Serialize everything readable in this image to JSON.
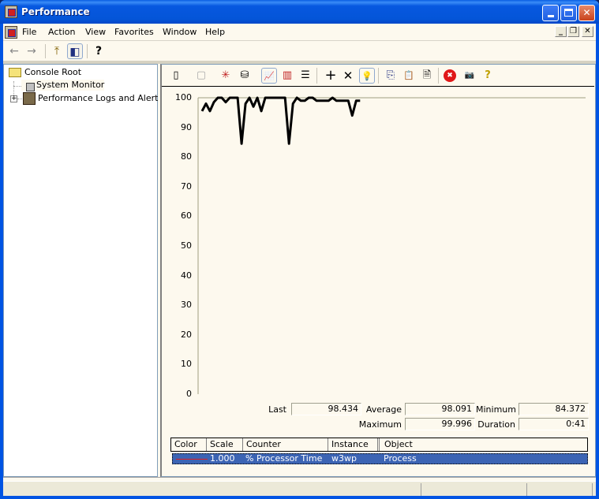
{
  "window": {
    "title": "Performance",
    "controls": {
      "minimize": "minimize",
      "maximize": "maximize",
      "close": "✕"
    }
  },
  "menubar": {
    "items": [
      "File",
      "Action",
      "View",
      "Favorites",
      "Window",
      "Help"
    ],
    "mdi_controls": {
      "minimize": "_",
      "restore": "❐",
      "close": "✕"
    }
  },
  "toolbar": {
    "buttons": [
      {
        "name": "back",
        "glyph": "←"
      },
      {
        "name": "forward",
        "glyph": "→"
      },
      {
        "name": "up-one-level",
        "glyph": "⤒"
      },
      {
        "name": "show-hide-console-tree",
        "glyph": "◧"
      },
      {
        "name": "help",
        "glyph": "?"
      }
    ]
  },
  "tree": {
    "root": "Console Root",
    "items": [
      {
        "label": "System Monitor",
        "selected": true
      },
      {
        "label": "Performance Logs and Alerts",
        "expander": "+"
      }
    ]
  },
  "system_monitor_toolbar": {
    "buttons": [
      {
        "name": "new-counter-set",
        "glyph": "▯"
      },
      {
        "name": "clear-display",
        "glyph": "▢"
      },
      {
        "name": "view-current-activity",
        "glyph": "✳"
      },
      {
        "name": "view-log-data",
        "glyph": "⛁"
      },
      {
        "name": "view-graph",
        "glyph": "📈",
        "pressed": true
      },
      {
        "name": "view-histogram",
        "glyph": "▥"
      },
      {
        "name": "view-report",
        "glyph": "☰"
      },
      {
        "name": "add",
        "glyph": "+"
      },
      {
        "name": "delete",
        "glyph": "✕"
      },
      {
        "name": "highlight",
        "glyph": "💡",
        "pressed": true
      },
      {
        "name": "copy-properties",
        "glyph": "⎘"
      },
      {
        "name": "paste-counter-list",
        "glyph": "📋"
      },
      {
        "name": "properties",
        "glyph": "🗎"
      },
      {
        "name": "freeze-display",
        "glyph": "✖"
      },
      {
        "name": "update-data",
        "glyph": "📷"
      },
      {
        "name": "help",
        "glyph": "?"
      }
    ]
  },
  "chart_data": {
    "type": "line",
    "title": "",
    "xlabel": "",
    "ylabel": "",
    "ylim": [
      0,
      100
    ],
    "yticks": [
      "100",
      "90",
      "80",
      "70",
      "60",
      "50",
      "40",
      "30",
      "20",
      "10",
      "0"
    ],
    "grid": false,
    "series": [
      {
        "name": "% Processor Time (w3wp)",
        "color": "#000000",
        "values": [
          95.5,
          98,
          95.5,
          98.5,
          100,
          100,
          98.5,
          100,
          100,
          100,
          84.5,
          98,
          100,
          97,
          100,
          95.5,
          100,
          100,
          100,
          100,
          100,
          100,
          84.5,
          98,
          100,
          99,
          99,
          100,
          100,
          99,
          99,
          99,
          99,
          100,
          99,
          99,
          99,
          99,
          94,
          99,
          99
        ]
      }
    ],
    "x_points_visible": 41,
    "x_points_capacity": 100
  },
  "stats": {
    "last_label": "Last",
    "last": "98.434",
    "average_label": "Average",
    "average": "98.091",
    "minimum_label": "Minimum",
    "minimum": "84.372",
    "maximum_label": "Maximum",
    "maximum": "99.996",
    "duration_label": "Duration",
    "duration": "0:41"
  },
  "legend": {
    "columns": [
      "Color",
      "Scale",
      "Counter",
      "Instance",
      "Object"
    ],
    "rows": [
      {
        "color": "#e02020",
        "scale": "1.000",
        "counter": "% Processor Time",
        "instance": "w3wp",
        "object": "Process"
      }
    ]
  }
}
